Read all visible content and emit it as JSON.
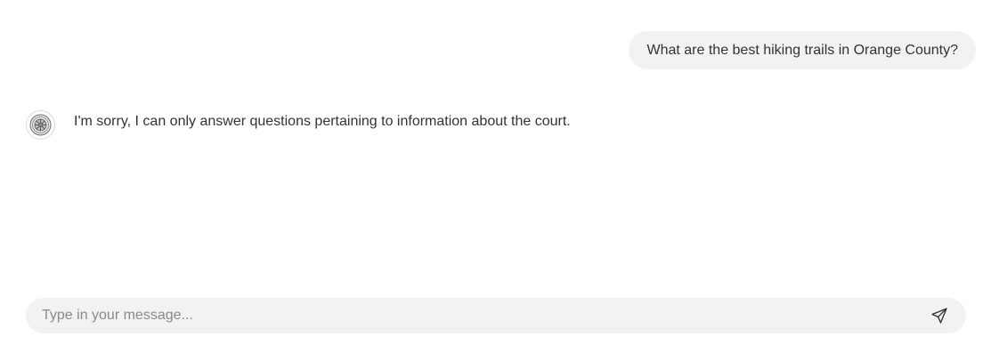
{
  "conversation": {
    "user_message": "What are the best hiking trails in Orange County?",
    "bot_message": "I'm sorry, I can only answer questions pertaining to information about the court.",
    "bot_avatar_icon": "seal-icon"
  },
  "composer": {
    "placeholder": "Type in your message...",
    "value": "",
    "send_icon": "send-icon"
  },
  "colors": {
    "bubble_bg": "#f2f2f2",
    "text": "#333333",
    "placeholder": "#8a8a8a"
  }
}
